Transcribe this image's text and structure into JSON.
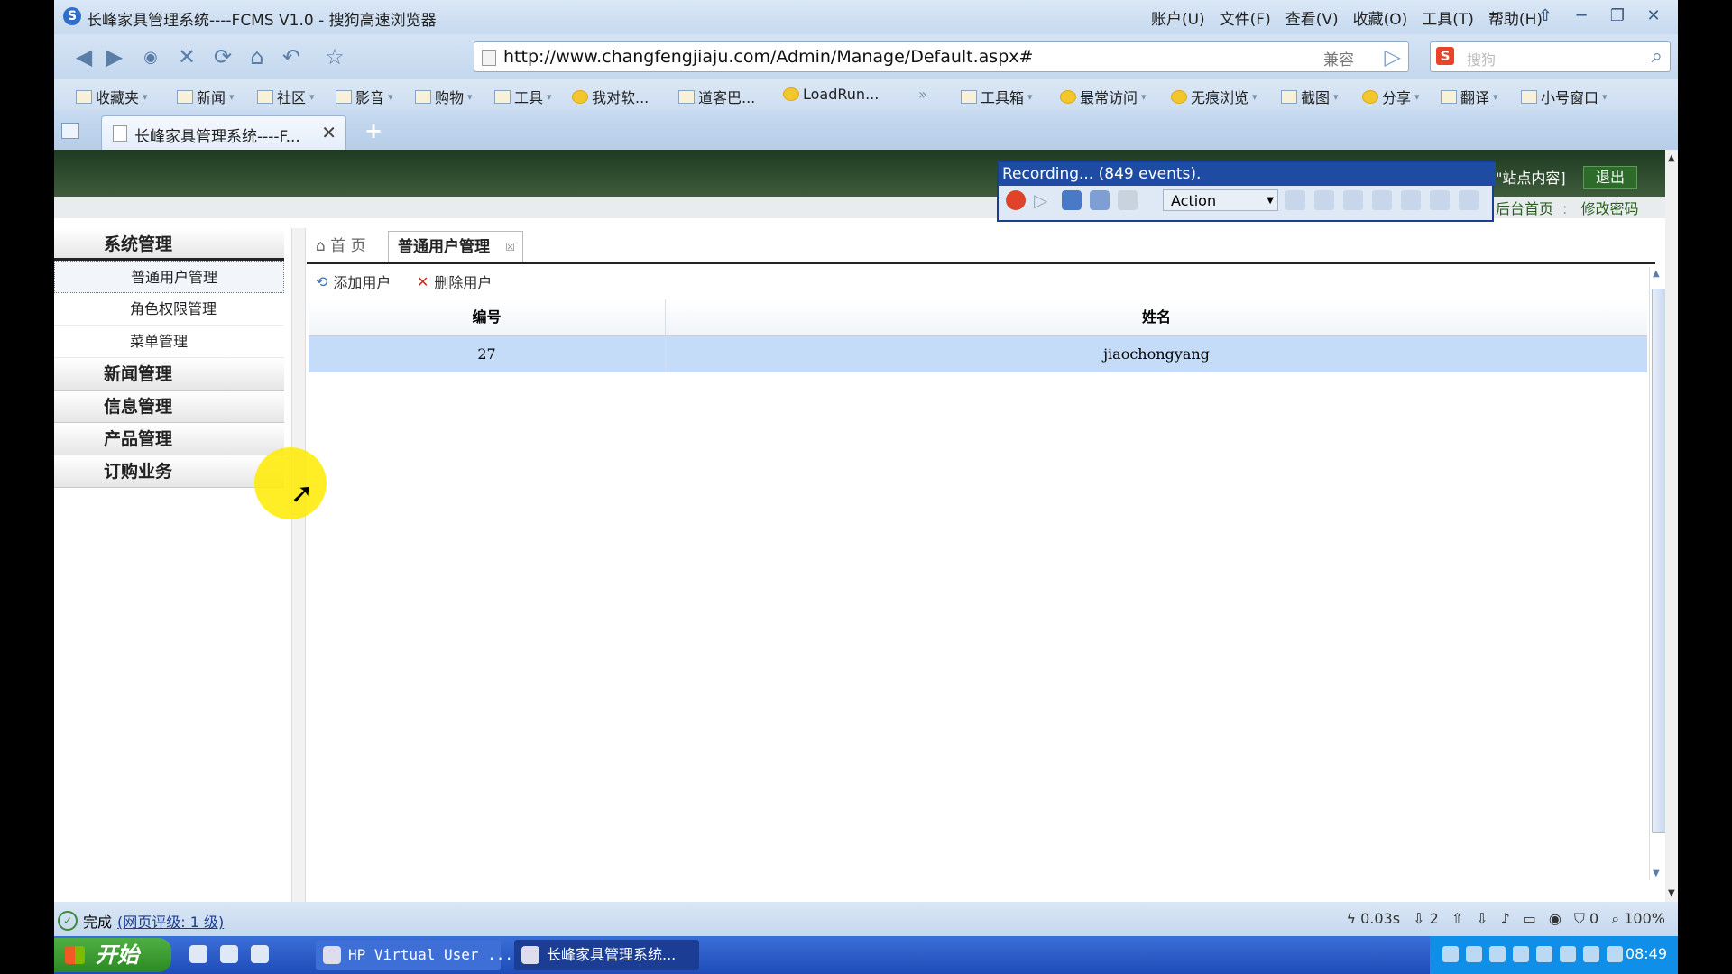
{
  "browser": {
    "title": "长峰家具管理系统----FCMS V1.0 - 搜狗高速浏览器",
    "menu": [
      "账户(U)",
      "文件(F)",
      "查看(V)",
      "收藏(O)",
      "工具(T)",
      "帮助(H)"
    ],
    "url": "http://www.changfengjiaju.com/Admin/Manage/Default.aspx#",
    "compat_label": "兼容",
    "search_placeholder": "搜狗",
    "bookmarks": [
      "收藏夹",
      "新闻",
      "社区",
      "影音",
      "购物",
      "工具",
      "我对软...",
      "道客巴...",
      "LoadRun...",
      "工具箱",
      "最常访问",
      "无痕浏览",
      "截图",
      "分享",
      "翻译",
      "小号窗口"
    ],
    "tab_title": "长峰家具管理系统----F...",
    "status": {
      "done": "完成",
      "rating": "(网页评级: 1 级)",
      "time": "0.03s",
      "count": "2",
      "blocked": "0",
      "zoom": "100%"
    }
  },
  "page": {
    "site_content": "\"站点内容]",
    "logout": "退出",
    "backend_home": "后台首页",
    "change_password": "修改密码",
    "nav": {
      "system": "系统管理",
      "sub_items": [
        "普通用户管理",
        "角色权限管理",
        "菜单管理"
      ],
      "sections": [
        "新闻管理",
        "信息管理",
        "产品管理",
        "订购业务"
      ]
    },
    "tabs": {
      "home": "首 页",
      "current": "普通用户管理"
    },
    "toolbar": {
      "add_user": "添加用户",
      "delete_user": "删除用户"
    },
    "grid": {
      "headers": [
        "编号",
        "姓名"
      ],
      "rows": [
        [
          "27",
          "jiaochongyang"
        ]
      ]
    }
  },
  "recorder": {
    "title": "Recording... (849 events).",
    "action": "Action"
  },
  "taskbar": {
    "start": "开始",
    "tasks": [
      "HP Virtual User ...",
      "长峰家具管理系统..."
    ],
    "clock": "08:49"
  }
}
